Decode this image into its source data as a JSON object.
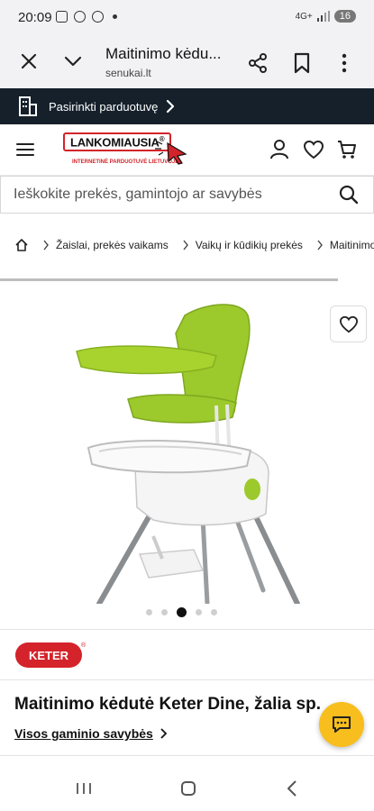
{
  "status_bar": {
    "time": "20:09",
    "network": "4G+",
    "battery": "16"
  },
  "browser": {
    "title": "Maitinimo kėdu...",
    "url": "senukai.lt",
    "icons": [
      "close-icon",
      "chevron-down-icon",
      "share-icon",
      "bookmark-icon",
      "more-icon"
    ]
  },
  "store_bar": {
    "label": "Pasirinkti parduotuvę",
    "icon": "store-icon"
  },
  "header": {
    "logo_main": "LANKOMIAUSIA",
    "logo_reg": "®",
    "logo_sub": "INTERNETINĖ PARDUOTUVĖ LIETUVOJE",
    "icons": [
      "menu-icon",
      "user-icon",
      "heart-icon",
      "cart-icon"
    ]
  },
  "search": {
    "placeholder": "Ieškokite prekės, gamintojo ar savybės"
  },
  "breadcrumb": {
    "items": [
      "Žaislai, prekės vaikams",
      "Vaikų ir kūdikių prekės",
      "Maitinimo kėdutės"
    ]
  },
  "gallery": {
    "slides": 5,
    "active_slide": 3
  },
  "brand": {
    "name": "KETER",
    "reg": "®"
  },
  "product": {
    "title": "Maitinimo kėdutė Keter Dine, žalia sp.",
    "properties_link": "Visos gaminio savybės"
  },
  "colors": {
    "store_bar_bg": "#15202b",
    "logo_red": "#d3242a",
    "chair_green": "#9cc92b",
    "chat_button": "#f7be1d",
    "keter_red": "#d4232b"
  }
}
